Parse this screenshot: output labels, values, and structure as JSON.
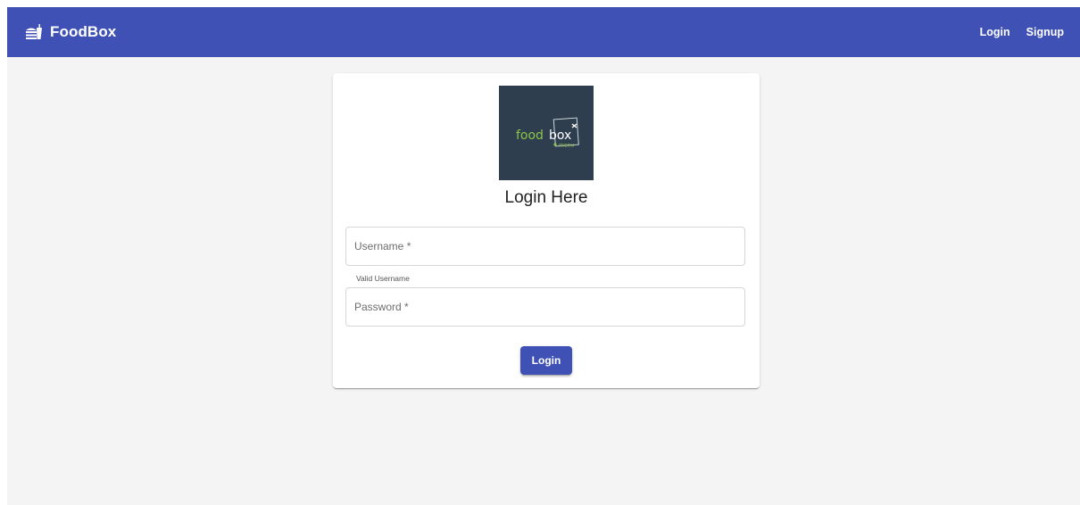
{
  "header": {
    "brand": "FoodBox",
    "nav": [
      "Login",
      "Signup"
    ],
    "accent_color": "#3f51b5",
    "brand_icon": "fastfood-icon"
  },
  "card": {
    "logo": {
      "text_food": "food",
      "text_box": "box",
      "text_menu": "menu",
      "background": "#2f3e4e",
      "accent": "#8bc34a"
    },
    "title": "Login Here",
    "username": {
      "value": "",
      "placeholder": "Username *",
      "hint": "Valid Username"
    },
    "password": {
      "value": "",
      "placeholder": "Password *"
    },
    "submit_label": "Login"
  }
}
